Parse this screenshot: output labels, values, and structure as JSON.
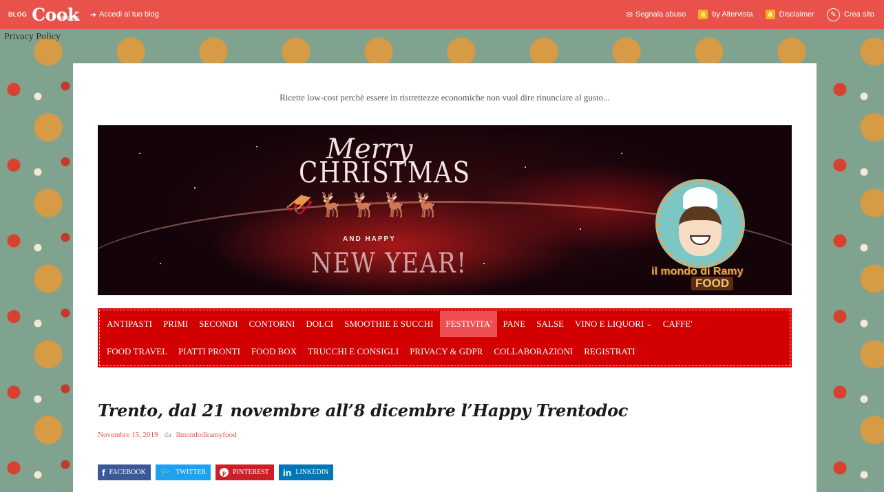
{
  "topbar": {
    "logo_blog": "BLOG",
    "logo_cook": "Cook",
    "logo_around": "AROUND",
    "login_link": "Accedi al tuo blog",
    "report_abuse": "Segnala abuso",
    "by_altervista": "by Altervista",
    "disclaimer": "Disclaimer",
    "create_site": "Crea sito",
    "badge_letter": "a"
  },
  "privacy_policy": "Privacy Policy",
  "tagline": "Ricette low-cost perchè essere in ristrettezze economiche non vuol dire rinunciare al gusto...",
  "banner": {
    "merry": "Merry",
    "christmas": "CHRISTMAS",
    "and_happy": "AND HAPPY",
    "new_year": "NEW YEAR!",
    "mascot_text": "il mondo di Ramy",
    "mascot_food": "FOOD"
  },
  "nav": {
    "row1": [
      "ANTIPASTI",
      "PRIMI",
      "SECONDI",
      "CONTORNI",
      "DOLCI",
      "SMOOTHIE E SUCCHI",
      "FESTIVITA'",
      "PANE",
      "SALSE",
      "VINO E LIQUORI",
      "CAFFE'"
    ],
    "row2": [
      "FOOD TRAVEL",
      "PIATTI PRONTI",
      "FOOD BOX",
      "TRUCCHI E CONSIGLI",
      "PRIVACY & GDPR",
      "COLLABORAZIONI",
      "REGISTRATI"
    ],
    "active": "FESTIVITA'"
  },
  "post": {
    "title": "Trento, dal 21 novembre all’8 dicembre l’Happy Trentodoc",
    "date": "Novembre 15, 2019",
    "by_label": "da",
    "author": "ilmondodiramyfood"
  },
  "share": {
    "facebook": "FACEBOOK",
    "twitter": "TWITTER",
    "pinterest": "PINTEREST",
    "linkedin": "LINKEDIN"
  },
  "colors": {
    "topbar": "#e8524a",
    "nav_bg": "#d20000",
    "nav_active": "#ef4e52",
    "meta_text": "#d75a4a"
  }
}
